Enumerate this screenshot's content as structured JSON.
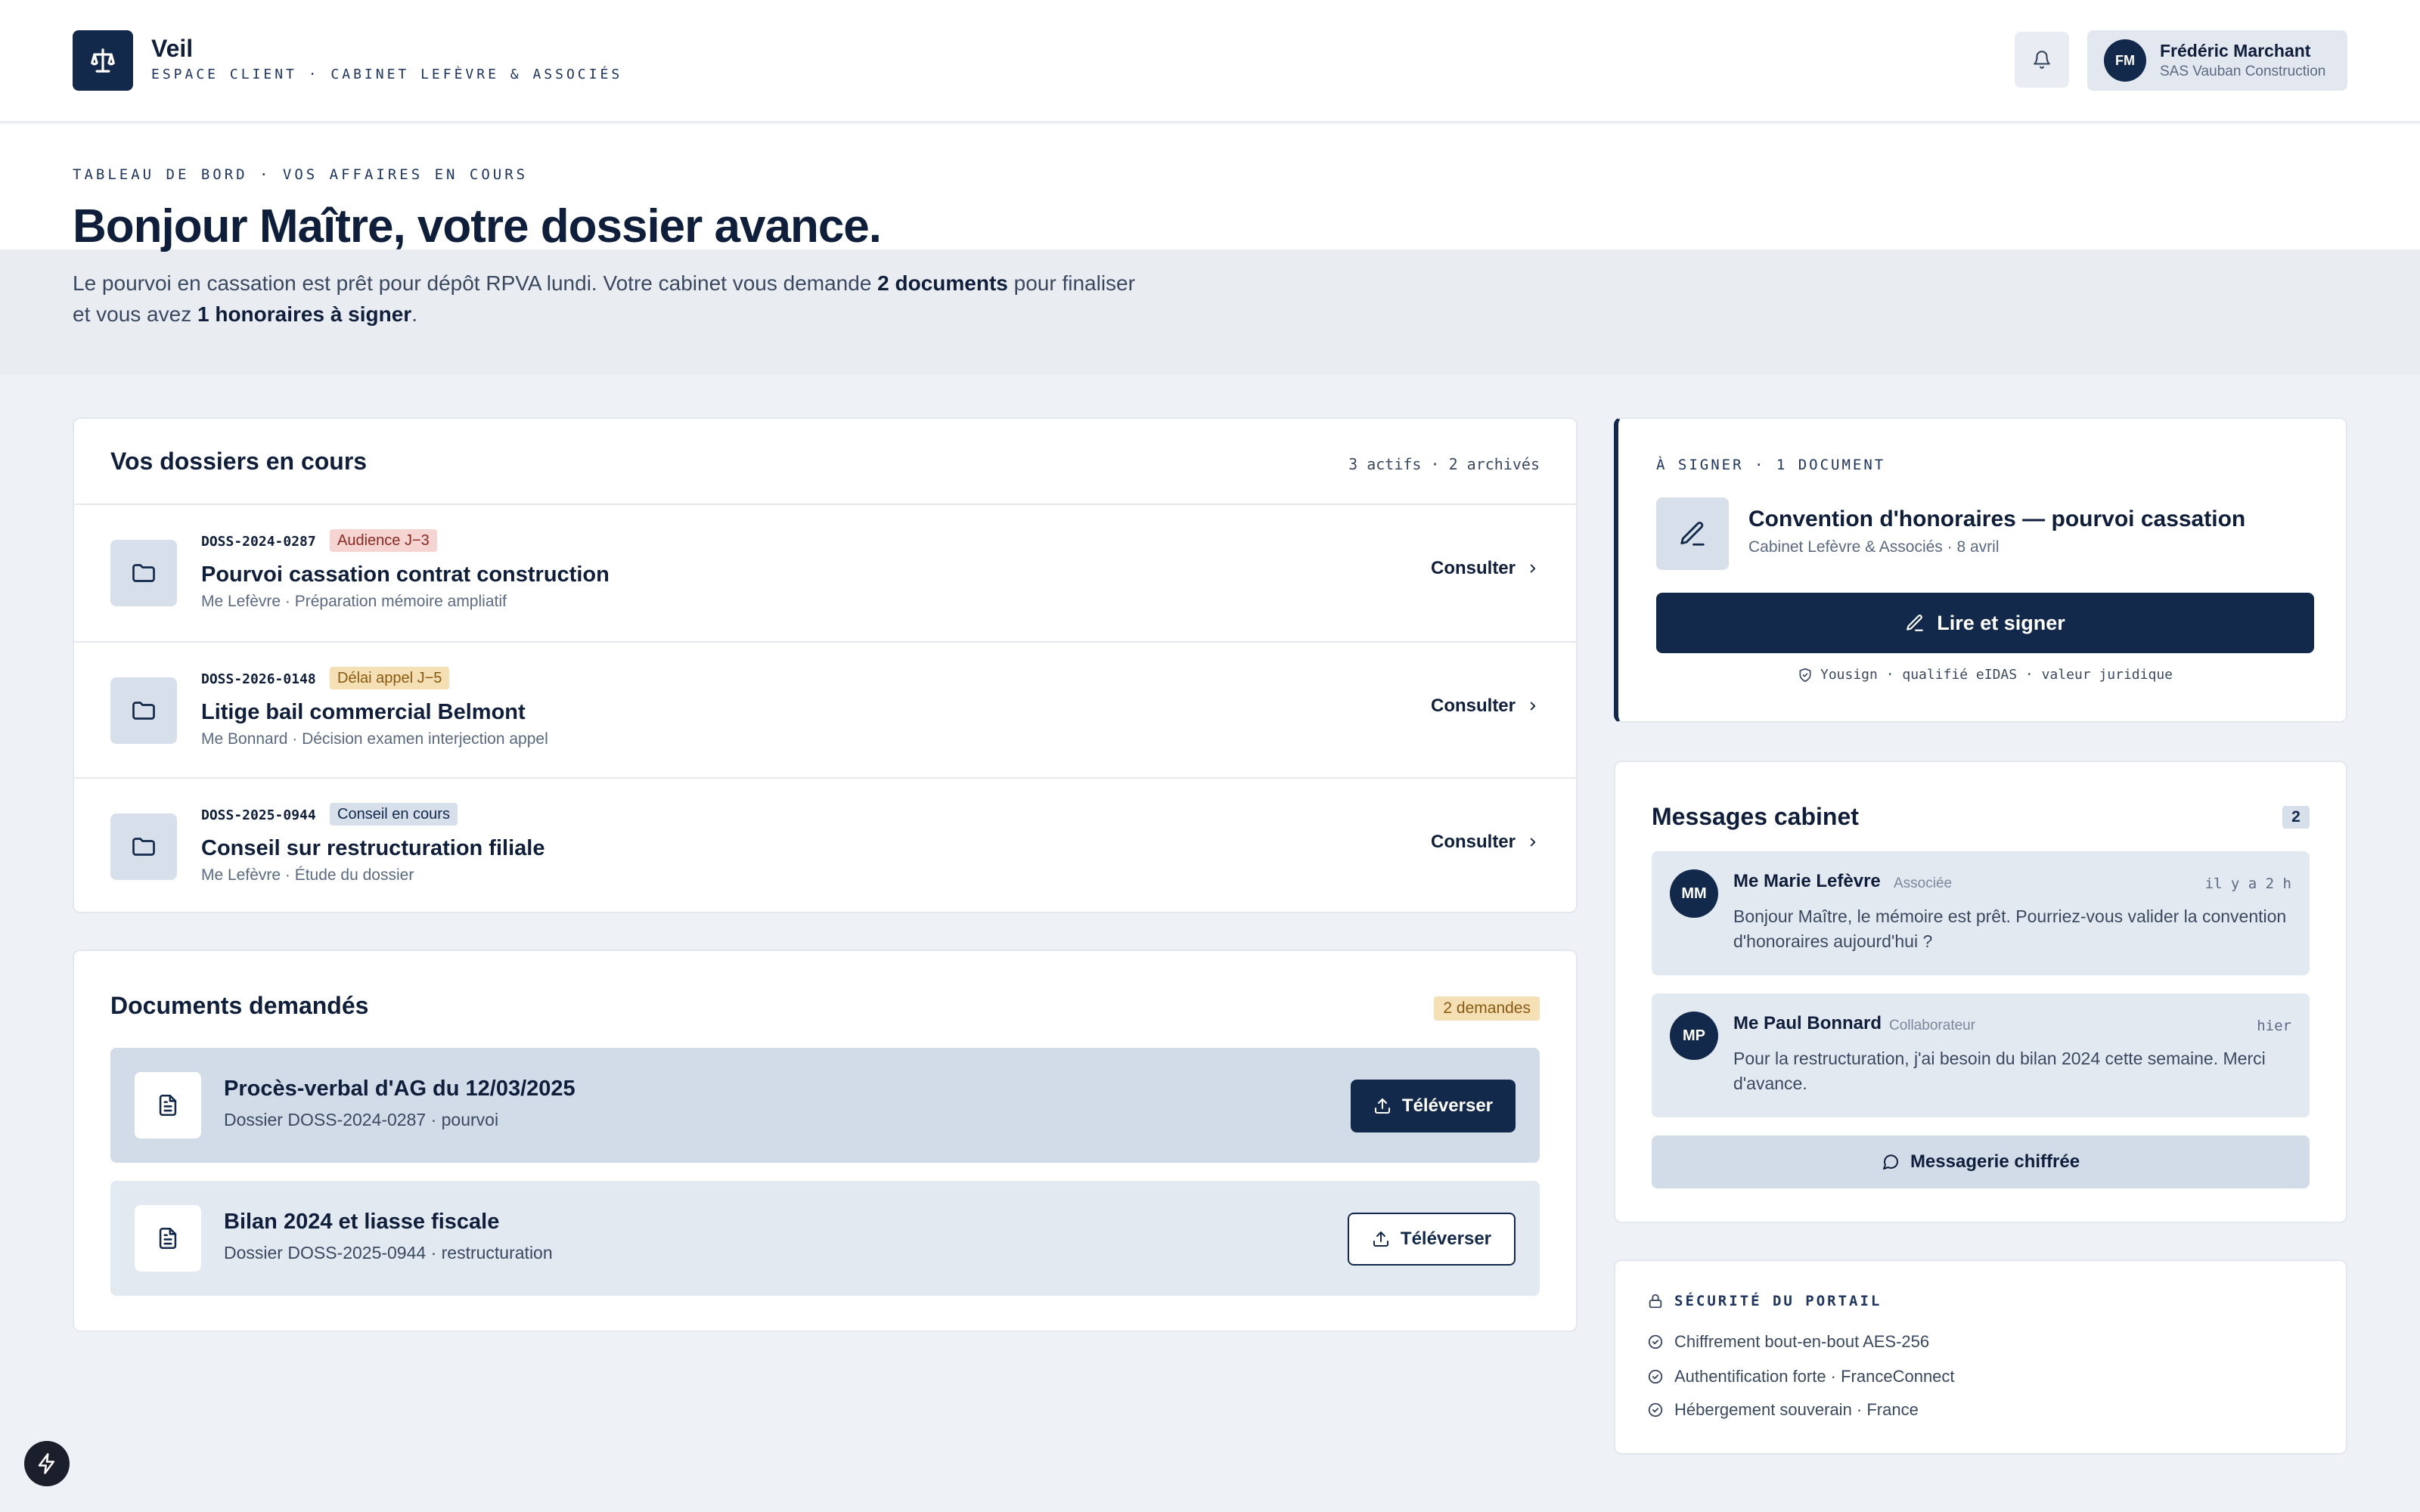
{
  "header": {
    "brand": "Veil",
    "subtitle": "ESPACE CLIENT · CABINET LEFÈVRE & ASSOCIÉS",
    "user": {
      "initials": "FM",
      "name": "Frédéric Marchant",
      "org": "SAS Vauban Construction"
    }
  },
  "hero": {
    "eyebrow": "TABLEAU DE BORD · VOS AFFAIRES EN COURS",
    "title": "Bonjour Maître, votre dossier avance.",
    "text_1": "Le pourvoi en cassation est prêt pour dépôt RPVA lundi. Votre cabinet vous demande ",
    "text_bold_1": "2 documents",
    "text_2": " pour finaliser et vous avez ",
    "text_bold_2": "1 honoraires à signer",
    "text_3": "."
  },
  "dossiers": {
    "title": "Vos dossiers en cours",
    "meta": "3 actifs · 2 archivés",
    "action_label": "Consulter",
    "items": [
      {
        "ref": "DOSS-2024-0287",
        "badge": "Audience J−3",
        "title": "Pourvoi cassation contrat construction",
        "sub": "Me Lefèvre · Préparation mémoire ampliatif"
      },
      {
        "ref": "DOSS-2026-0148",
        "badge": "Délai appel J−5",
        "title": "Litige bail commercial Belmont",
        "sub": "Me Bonnard · Décision examen interjection appel"
      },
      {
        "ref": "DOSS-2025-0944",
        "badge": "Conseil en cours",
        "title": "Conseil sur restructuration filiale",
        "sub": "Me Lefèvre · Étude du dossier"
      }
    ]
  },
  "documents": {
    "title": "Documents demandés",
    "badge": "2 demandes",
    "upload_label": "Téléverser",
    "items": [
      {
        "title": "Procès-verbal d'AG du 12/03/2025",
        "sub": "Dossier DOSS-2024-0287 · pourvoi"
      },
      {
        "title": "Bilan 2024 et liasse fiscale",
        "sub": "Dossier DOSS-2025-0944 · restructuration"
      }
    ]
  },
  "sign": {
    "eyebrow": "À SIGNER · 1 DOCUMENT",
    "title": "Convention d'honoraires — pourvoi cassation",
    "sub": "Cabinet Lefèvre & Associés · 8 avril",
    "button": "Lire et signer",
    "footer": "Yousign · qualifié eIDAS · valeur juridique"
  },
  "messages": {
    "title": "Messages cabinet",
    "count": "2",
    "items": [
      {
        "initials": "MM",
        "author": "Me Marie Lefèvre",
        "role": "Associée",
        "time": "il y a 2 h",
        "text": "Bonjour Maître, le mémoire est prêt. Pourriez-vous valider la convention d'honoraires aujourd'hui ?"
      },
      {
        "initials": "MP",
        "author": "Me Paul Bonnard",
        "role": "Collaborateur",
        "time": "hier",
        "text": "Pour la restructuration, j'ai besoin du bilan 2024 cette semaine. Merci d'avance."
      }
    ],
    "button": "Messagerie chiffrée"
  },
  "security": {
    "title": "SÉCURITÉ DU PORTAIL",
    "items": [
      "Chiffrement bout-en-bout AES-256",
      "Authentification forte · FranceConnect",
      "Hébergement souverain · France"
    ]
  },
  "colors": {
    "navy": "#13294b",
    "badge_red": "#f5d4d1",
    "badge_amber": "#f5dfb4",
    "badge_blue": "#d6dfea"
  }
}
